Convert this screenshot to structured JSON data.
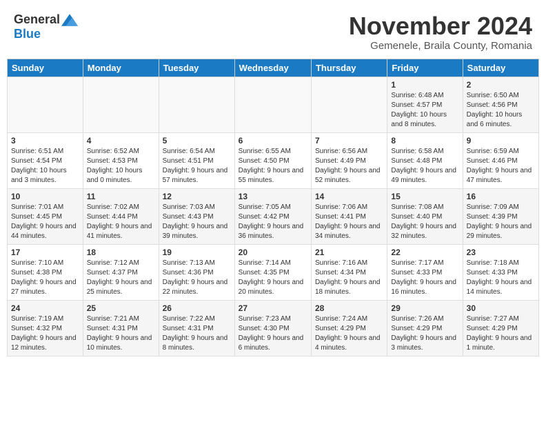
{
  "header": {
    "logo_general": "General",
    "logo_blue": "Blue",
    "month_title": "November 2024",
    "subtitle": "Gemenele, Braila County, Romania"
  },
  "days_of_week": [
    "Sunday",
    "Monday",
    "Tuesday",
    "Wednesday",
    "Thursday",
    "Friday",
    "Saturday"
  ],
  "weeks": [
    [
      {
        "day": "",
        "info": ""
      },
      {
        "day": "",
        "info": ""
      },
      {
        "day": "",
        "info": ""
      },
      {
        "day": "",
        "info": ""
      },
      {
        "day": "",
        "info": ""
      },
      {
        "day": "1",
        "info": "Sunrise: 6:48 AM\nSunset: 4:57 PM\nDaylight: 10 hours and 8 minutes."
      },
      {
        "day": "2",
        "info": "Sunrise: 6:50 AM\nSunset: 4:56 PM\nDaylight: 10 hours and 6 minutes."
      }
    ],
    [
      {
        "day": "3",
        "info": "Sunrise: 6:51 AM\nSunset: 4:54 PM\nDaylight: 10 hours and 3 minutes."
      },
      {
        "day": "4",
        "info": "Sunrise: 6:52 AM\nSunset: 4:53 PM\nDaylight: 10 hours and 0 minutes."
      },
      {
        "day": "5",
        "info": "Sunrise: 6:54 AM\nSunset: 4:51 PM\nDaylight: 9 hours and 57 minutes."
      },
      {
        "day": "6",
        "info": "Sunrise: 6:55 AM\nSunset: 4:50 PM\nDaylight: 9 hours and 55 minutes."
      },
      {
        "day": "7",
        "info": "Sunrise: 6:56 AM\nSunset: 4:49 PM\nDaylight: 9 hours and 52 minutes."
      },
      {
        "day": "8",
        "info": "Sunrise: 6:58 AM\nSunset: 4:48 PM\nDaylight: 9 hours and 49 minutes."
      },
      {
        "day": "9",
        "info": "Sunrise: 6:59 AM\nSunset: 4:46 PM\nDaylight: 9 hours and 47 minutes."
      }
    ],
    [
      {
        "day": "10",
        "info": "Sunrise: 7:01 AM\nSunset: 4:45 PM\nDaylight: 9 hours and 44 minutes."
      },
      {
        "day": "11",
        "info": "Sunrise: 7:02 AM\nSunset: 4:44 PM\nDaylight: 9 hours and 41 minutes."
      },
      {
        "day": "12",
        "info": "Sunrise: 7:03 AM\nSunset: 4:43 PM\nDaylight: 9 hours and 39 minutes."
      },
      {
        "day": "13",
        "info": "Sunrise: 7:05 AM\nSunset: 4:42 PM\nDaylight: 9 hours and 36 minutes."
      },
      {
        "day": "14",
        "info": "Sunrise: 7:06 AM\nSunset: 4:41 PM\nDaylight: 9 hours and 34 minutes."
      },
      {
        "day": "15",
        "info": "Sunrise: 7:08 AM\nSunset: 4:40 PM\nDaylight: 9 hours and 32 minutes."
      },
      {
        "day": "16",
        "info": "Sunrise: 7:09 AM\nSunset: 4:39 PM\nDaylight: 9 hours and 29 minutes."
      }
    ],
    [
      {
        "day": "17",
        "info": "Sunrise: 7:10 AM\nSunset: 4:38 PM\nDaylight: 9 hours and 27 minutes."
      },
      {
        "day": "18",
        "info": "Sunrise: 7:12 AM\nSunset: 4:37 PM\nDaylight: 9 hours and 25 minutes."
      },
      {
        "day": "19",
        "info": "Sunrise: 7:13 AM\nSunset: 4:36 PM\nDaylight: 9 hours and 22 minutes."
      },
      {
        "day": "20",
        "info": "Sunrise: 7:14 AM\nSunset: 4:35 PM\nDaylight: 9 hours and 20 minutes."
      },
      {
        "day": "21",
        "info": "Sunrise: 7:16 AM\nSunset: 4:34 PM\nDaylight: 9 hours and 18 minutes."
      },
      {
        "day": "22",
        "info": "Sunrise: 7:17 AM\nSunset: 4:33 PM\nDaylight: 9 hours and 16 minutes."
      },
      {
        "day": "23",
        "info": "Sunrise: 7:18 AM\nSunset: 4:33 PM\nDaylight: 9 hours and 14 minutes."
      }
    ],
    [
      {
        "day": "24",
        "info": "Sunrise: 7:19 AM\nSunset: 4:32 PM\nDaylight: 9 hours and 12 minutes."
      },
      {
        "day": "25",
        "info": "Sunrise: 7:21 AM\nSunset: 4:31 PM\nDaylight: 9 hours and 10 minutes."
      },
      {
        "day": "26",
        "info": "Sunrise: 7:22 AM\nSunset: 4:31 PM\nDaylight: 9 hours and 8 minutes."
      },
      {
        "day": "27",
        "info": "Sunrise: 7:23 AM\nSunset: 4:30 PM\nDaylight: 9 hours and 6 minutes."
      },
      {
        "day": "28",
        "info": "Sunrise: 7:24 AM\nSunset: 4:29 PM\nDaylight: 9 hours and 4 minutes."
      },
      {
        "day": "29",
        "info": "Sunrise: 7:26 AM\nSunset: 4:29 PM\nDaylight: 9 hours and 3 minutes."
      },
      {
        "day": "30",
        "info": "Sunrise: 7:27 AM\nSunset: 4:29 PM\nDaylight: 9 hours and 1 minute."
      }
    ]
  ]
}
